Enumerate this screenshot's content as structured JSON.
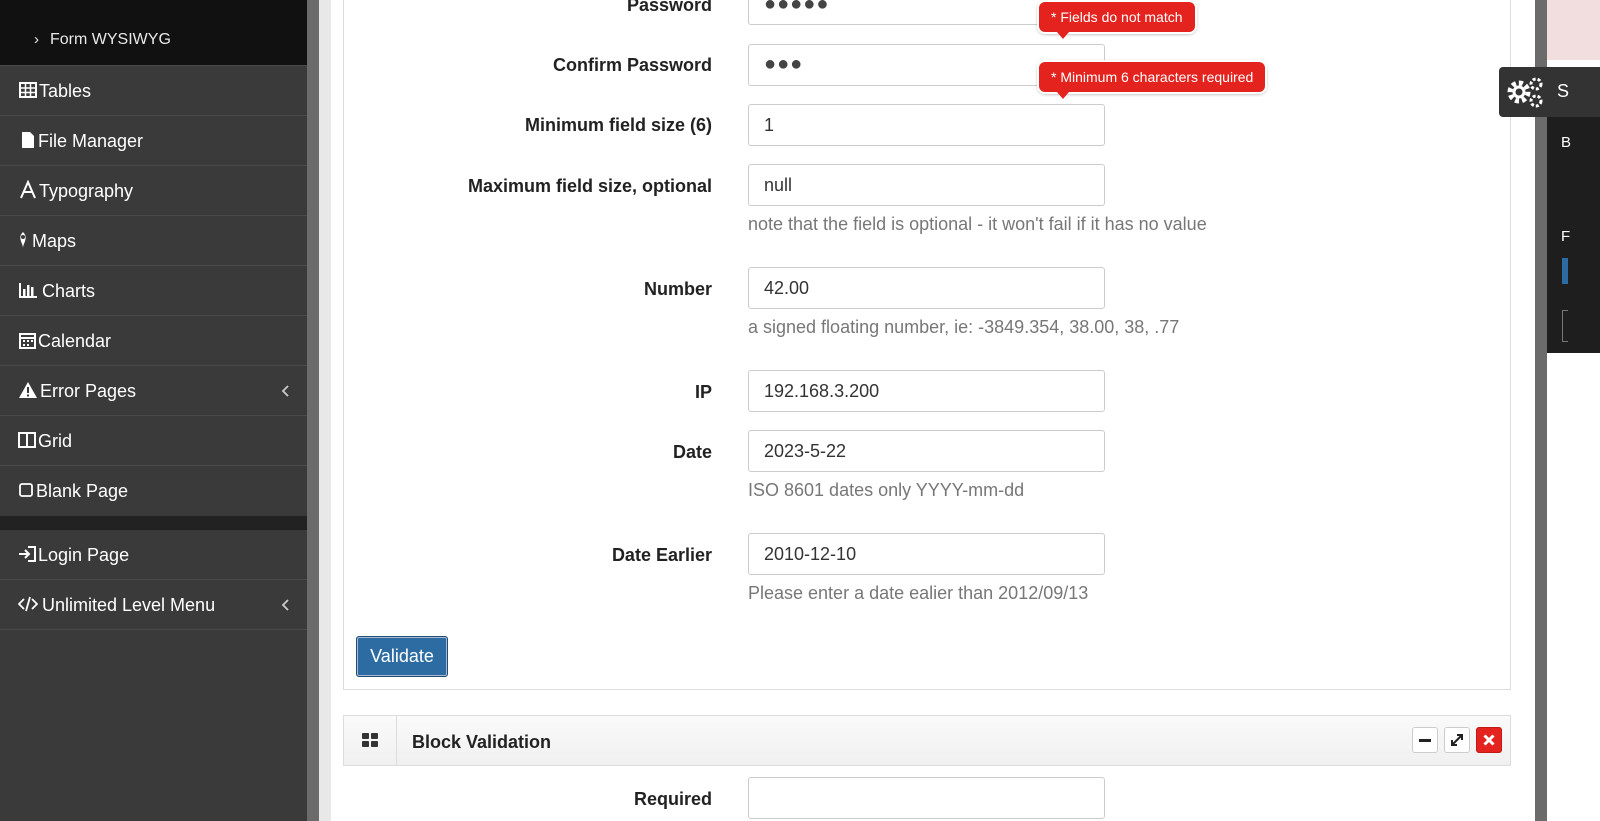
{
  "sidebar": {
    "sub_item": "Form WYSIWYG",
    "items": [
      {
        "label": "Tables",
        "icon": "table-icon"
      },
      {
        "label": "File Manager",
        "icon": "file-icon"
      },
      {
        "label": "Typography",
        "icon": "font-icon"
      },
      {
        "label": "Maps",
        "icon": "map-marker-icon"
      },
      {
        "label": "Charts",
        "icon": "bar-chart-icon"
      },
      {
        "label": "Calendar",
        "icon": "calendar-icon"
      },
      {
        "label": "Error Pages",
        "icon": "warning-icon",
        "has_submenu": true
      },
      {
        "label": "Grid",
        "icon": "columns-icon"
      },
      {
        "label": "Blank Page",
        "icon": "square-icon"
      },
      {
        "label": "Login Page",
        "icon": "sign-in-icon"
      },
      {
        "label": "Unlimited Level Menu",
        "icon": "code-icon",
        "has_submenu": true
      }
    ]
  },
  "form": {
    "password": {
      "label": "Password",
      "value": "●●●●●"
    },
    "confirm_password": {
      "label": "Confirm Password",
      "value": "●●●"
    },
    "min_size": {
      "label": "Minimum field size (6)",
      "value": "1"
    },
    "max_size": {
      "label": "Maximum field size, optional",
      "value": "null",
      "help": "note that the field is optional - it won't fail if it has no value"
    },
    "number": {
      "label": "Number",
      "value": "42.00",
      "help": "a signed floating number, ie: -3849.354, 38.00, 38, .77"
    },
    "ip": {
      "label": "IP",
      "value": "192.168.3.200"
    },
    "date": {
      "label": "Date",
      "value": "2023-5-22",
      "help": "ISO 8601 dates only YYYY-mm-dd"
    },
    "date_earlier": {
      "label": "Date Earlier",
      "value": "2010-12-10",
      "help": "Please enter a date ealier than 2012/09/13"
    },
    "errors": {
      "fields_mismatch": "* Fields do not match",
      "min_chars": "* Minimum 6 characters required"
    },
    "validate_label": "Validate"
  },
  "block_validation": {
    "title": "Block Validation",
    "required_label": "Required"
  },
  "right_panel": {
    "settings_letter": "S",
    "letter_b": "B",
    "letter_f": "F"
  },
  "colors": {
    "sidebar_bg": "#3a3a3a",
    "error_red": "#e5231e",
    "primary_blue": "#2d6ca2"
  }
}
